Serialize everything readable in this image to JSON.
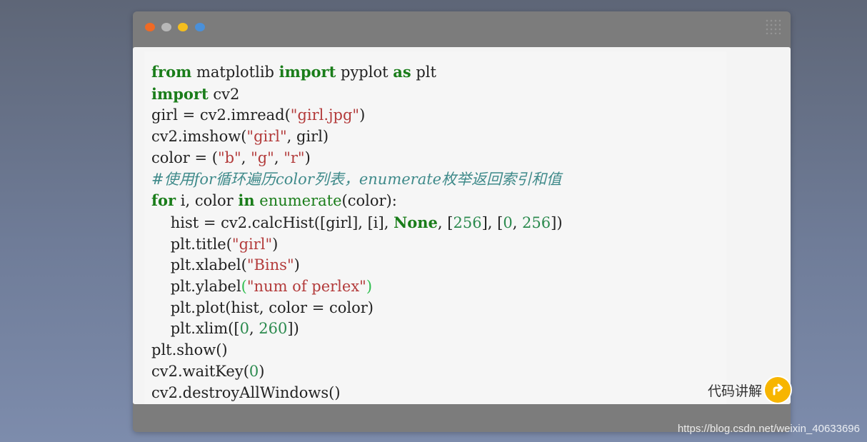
{
  "window": {
    "traffic_lights": [
      {
        "name": "close",
        "color": "#f06a24"
      },
      {
        "name": "minimize",
        "color": "#b8b8b8"
      },
      {
        "name": "maximize",
        "color": "#f4be1e"
      },
      {
        "name": "extra",
        "color": "#4a90d9"
      }
    ]
  },
  "code": {
    "language": "python",
    "lines": [
      "from matplotlib import pyplot as plt",
      "import cv2",
      "girl = cv2.imread(\"girl.jpg\")",
      "cv2.imshow(\"girl\", girl)",
      "color = (\"b\", \"g\", \"r\")",
      "#使用for循环遍历color列表，enumerate枚举返回索引和值",
      "for i, color in enumerate(color):",
      "    hist = cv2.calcHist([girl], [i], None, [256], [0, 256])",
      "    plt.title(\"girl\")",
      "    plt.xlabel(\"Bins\")",
      "    plt.ylabel(\"num of perlex\")",
      "    plt.plot(hist, color = color)",
      "    plt.xlim([0, 260])",
      "plt.show()",
      "cv2.waitKey(0)",
      "cv2.destroyAllWindows()"
    ]
  },
  "explain": {
    "label": "代码讲解",
    "icon": "turn-right-arrow-icon",
    "accent": "#f7b500"
  },
  "watermark": "https://blog.csdn.net/weixin_40633696"
}
